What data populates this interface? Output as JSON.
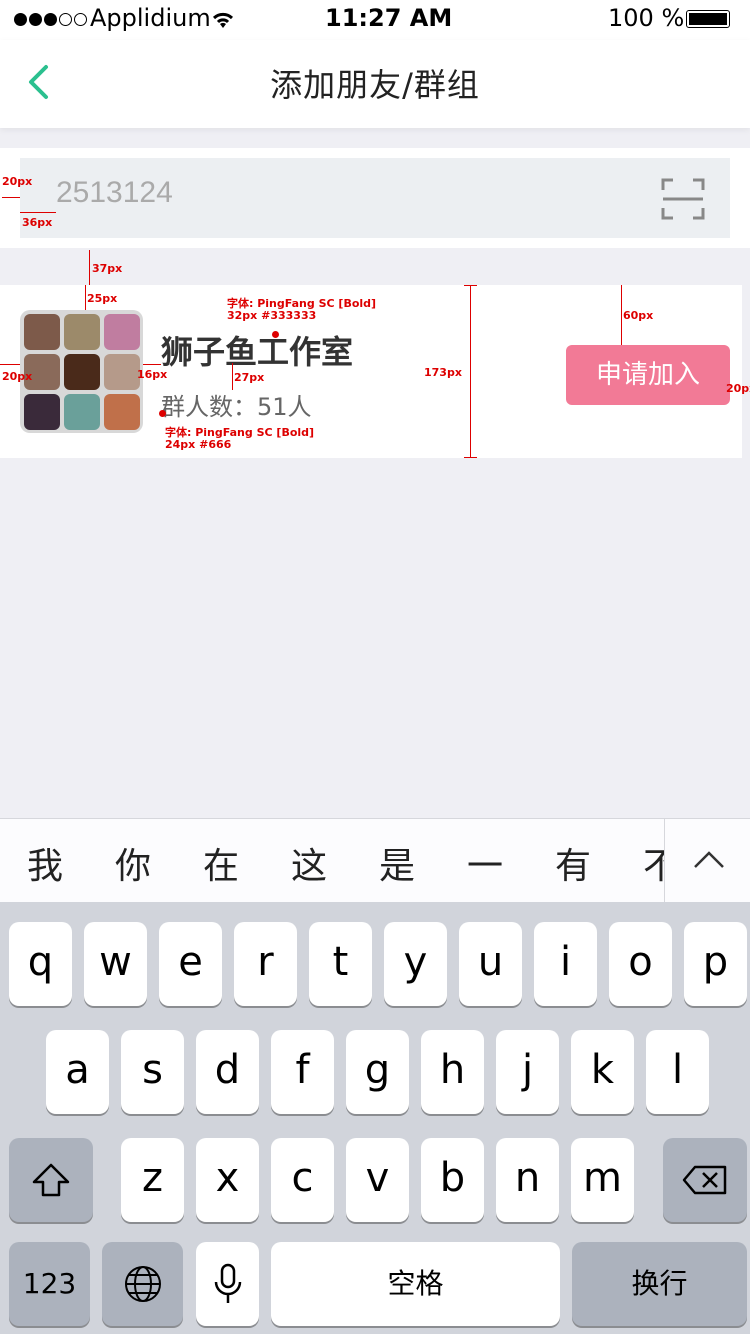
{
  "status_bar": {
    "carrier": "Applidium",
    "time": "11:27 AM",
    "battery": "100 %"
  },
  "nav": {
    "title": "添加朋友/群组"
  },
  "search": {
    "value": "2513124"
  },
  "group": {
    "name": "狮子鱼工作室",
    "members_label": "群人数：51人",
    "join_label": "申请加入"
  },
  "annotations": {
    "d20a": "20px",
    "d36": "36px",
    "d37": "37px",
    "d25": "25px",
    "font_name_line1": "字体: PingFang SC [Bold]",
    "font_name_line2": "32px #333333",
    "d20b": "20px",
    "d16": "16px",
    "d27": "27px",
    "d173": "173px",
    "d60": "60px",
    "d20c": "20px",
    "font_count_line1": "字体: PingFang SC [Bold]",
    "font_count_line2": "24px #666"
  },
  "keyboard": {
    "candidates": [
      "我",
      "你",
      "在",
      "这",
      "是",
      "一",
      "有",
      "不"
    ],
    "row1": [
      "q",
      "w",
      "e",
      "r",
      "t",
      "y",
      "u",
      "i",
      "o",
      "p"
    ],
    "row2": [
      "a",
      "s",
      "d",
      "f",
      "g",
      "h",
      "j",
      "k",
      "l"
    ],
    "row3": [
      "z",
      "x",
      "c",
      "v",
      "b",
      "n",
      "m"
    ],
    "numbers": "123",
    "space": "空格",
    "return": "换行"
  },
  "colors": {
    "accent": "#2bc08f",
    "join_button": "#f27a96",
    "annotation": "#dd0000"
  }
}
